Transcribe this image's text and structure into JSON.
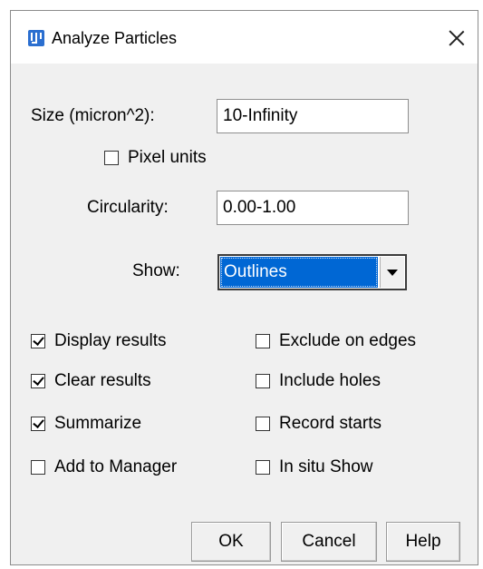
{
  "window": {
    "title": "Analyze Particles",
    "icon": "imagej-icon",
    "close_icon": "close-icon"
  },
  "size": {
    "label": "Size (micron^2):",
    "value": "10-Infinity"
  },
  "pixel_units": {
    "label": "Pixel units",
    "checked": false
  },
  "circularity": {
    "label": "Circularity:",
    "value": "0.00-1.00"
  },
  "show": {
    "label": "Show:",
    "selected": "Outlines"
  },
  "options": {
    "display_results": {
      "label": "Display results",
      "checked": true
    },
    "clear_results": {
      "label": "Clear results",
      "checked": true
    },
    "summarize": {
      "label": "Summarize",
      "checked": true
    },
    "add_to_manager": {
      "label": "Add to Manager",
      "checked": false
    },
    "exclude_on_edges": {
      "label": "Exclude on edges",
      "checked": false
    },
    "include_holes": {
      "label": "Include holes",
      "checked": false
    },
    "record_starts": {
      "label": "Record starts",
      "checked": false
    },
    "in_situ_show": {
      "label": "In situ Show",
      "checked": false
    }
  },
  "buttons": {
    "ok": "OK",
    "cancel": "Cancel",
    "help": "Help"
  }
}
